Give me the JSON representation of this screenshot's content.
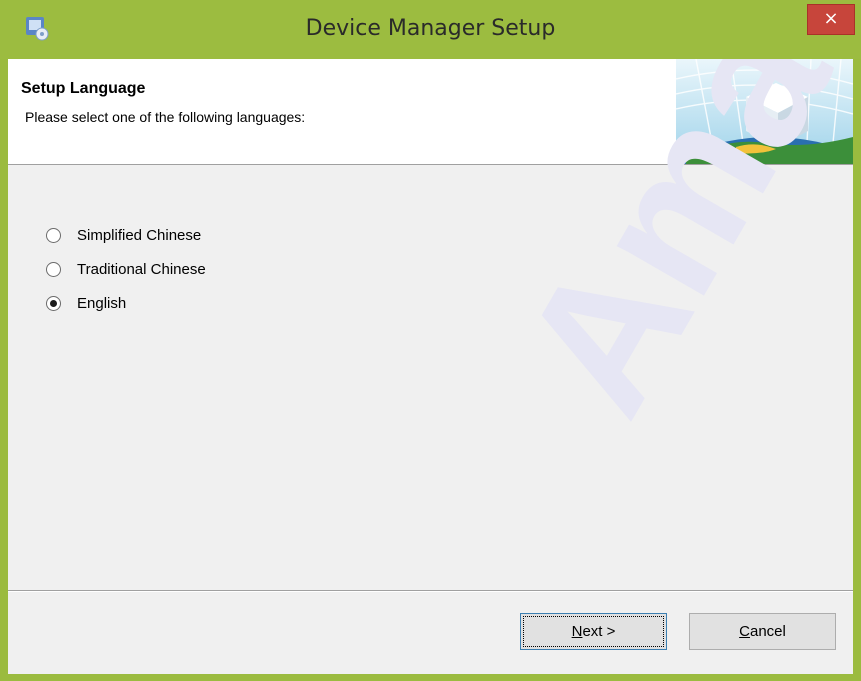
{
  "window": {
    "title": "Device Manager Setup",
    "close_glyph": "×",
    "app_icon": "setup-app-icon",
    "titlebar_color": "#9cbc40",
    "close_color": "#c7453b"
  },
  "header": {
    "title": "Setup Language",
    "subtitle": "Please select one of the following languages:"
  },
  "watermark": {
    "text": "Amate"
  },
  "languages": {
    "options": [
      {
        "label": "Simplified Chinese",
        "selected": false
      },
      {
        "label": "Traditional Chinese",
        "selected": false
      },
      {
        "label": "English",
        "selected": true
      }
    ]
  },
  "buttons": {
    "next_label": "Next >",
    "next_mnemonic": "N",
    "cancel_label": "Cancel",
    "cancel_mnemonic": "C"
  }
}
